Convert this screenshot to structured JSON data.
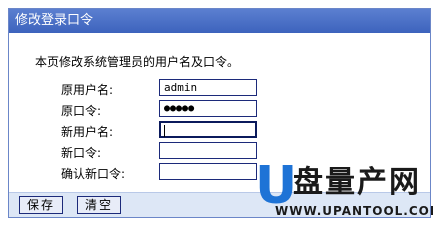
{
  "window": {
    "title": "修改登录口令"
  },
  "form": {
    "description": "本页修改系统管理员的用户名及口令。",
    "fields": [
      {
        "label": "原用户名:",
        "value": "admin"
      },
      {
        "label": "原口令:",
        "value": "●●●●●"
      },
      {
        "label": "新用户名:",
        "value": ""
      },
      {
        "label": "新口令:",
        "value": ""
      },
      {
        "label": "确认新口令:",
        "value": ""
      }
    ]
  },
  "buttons": {
    "save": "保存",
    "clear": "清空"
  },
  "watermark": {
    "logo_letter": "U",
    "logo_text": "盘量产网",
    "url": "WWW.UPANTOOL.COM"
  }
}
